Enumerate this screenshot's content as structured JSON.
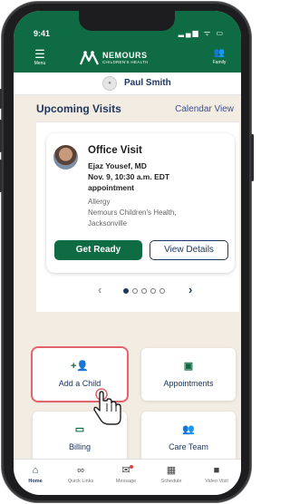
{
  "status": {
    "time": "9:41",
    "icons": "▂▄▆ ᯤ ▭"
  },
  "header": {
    "menu_label": "Menu",
    "family_label": "Family",
    "logo_text": "NEMOURS",
    "logo_sub": "CHILDREN'S HEALTH"
  },
  "patient": {
    "name": "Paul Smith"
  },
  "visits": {
    "title": "Upcoming Visits",
    "calendar_link": "Calendar View",
    "card": {
      "type": "Office Visit",
      "doctor": "Ejaz Yousef, MD",
      "time": "Nov. 9, 10:30 a.m. EDT",
      "appointment": "appointment",
      "department": "Allergy",
      "location_line1": "Nemours Children's Health,",
      "location_line2": "Jacksonville",
      "get_ready": "Get Ready",
      "view_details": "View Details"
    },
    "pager": {
      "prev": "‹",
      "next": "›",
      "dots": 5,
      "active_dot": 1
    }
  },
  "tiles": [
    {
      "label": "Add a Child",
      "icon": "add-person-icon"
    },
    {
      "label": "Appointments",
      "icon": "calendar-icon"
    },
    {
      "label": "Billing",
      "icon": "card-icon"
    },
    {
      "label": "Care Team",
      "icon": "group-icon"
    }
  ],
  "nav": [
    {
      "label": "Home",
      "icon": "home-icon"
    },
    {
      "label": "Quick Links",
      "icon": "link-icon"
    },
    {
      "label": "Message",
      "icon": "message-icon"
    },
    {
      "label": "Schedule",
      "icon": "schedule-icon"
    },
    {
      "label": "Video Visit",
      "icon": "video-icon"
    }
  ],
  "colors": {
    "brand_green": "#0f6b43",
    "navy": "#1f3760",
    "highlight": "#e5636b"
  }
}
